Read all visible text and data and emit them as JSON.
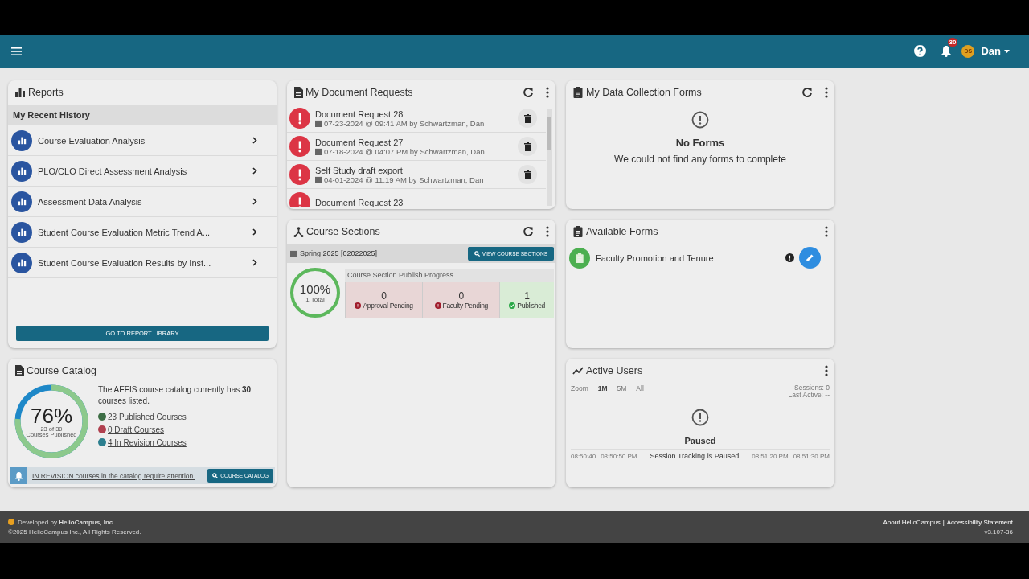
{
  "header": {
    "notification_count": "30",
    "avatar_initials": "DS",
    "user_name": "Dan"
  },
  "reports": {
    "title": "Reports",
    "section": "My Recent History",
    "items": [
      {
        "label": "Course Evaluation Analysis"
      },
      {
        "label": "PLO/CLO Direct Assessment Analysis"
      },
      {
        "label": "Assessment Data Analysis"
      },
      {
        "label": "Student Course Evaluation Metric Trend A..."
      },
      {
        "label": "Student Course Evaluation Results by Inst..."
      }
    ],
    "button": "GO TO REPORT LIBRARY"
  },
  "document_requests": {
    "title": "My Document Requests",
    "items": [
      {
        "title": "Document Request 28",
        "meta": "07-23-2024 @ 09:41 AM by Schwartzman, Dan"
      },
      {
        "title": "Document Request 27",
        "meta": "07-18-2024 @ 04:07 PM by Schwartzman, Dan"
      },
      {
        "title": "Self Study draft export",
        "meta": "04-01-2024 @ 11:19 AM by Schwartzman, Dan"
      },
      {
        "title": "Document Request 23"
      }
    ]
  },
  "data_collection_forms": {
    "title": "My Data Collection Forms",
    "empty_title": "No Forms",
    "empty_message": "We could not find any forms to complete"
  },
  "course_sections": {
    "title": "Course Sections",
    "term": "Spring 2025 [02022025]",
    "button": "VIEW COURSE SECTIONS",
    "percent": "100%",
    "total": "1 Total",
    "level": 1,
    "progress_title": "Course Section Publish Progress",
    "stages": [
      {
        "count": "0",
        "label": "Approval Pending",
        "kind": "pending"
      },
      {
        "count": "0",
        "label": "Faculty Pending",
        "kind": "pending"
      },
      {
        "count": "1",
        "label": "Published",
        "kind": "done"
      }
    ]
  },
  "available_forms": {
    "title": "Available Forms",
    "items": [
      {
        "name": "Faculty Promotion and Tenure"
      }
    ]
  },
  "course_catalog": {
    "title": "Course Catalog",
    "percent": "76%",
    "caption_1": "23 of 30",
    "caption_2": "Courses Published",
    "level": 0.76,
    "summary": "The AEFIS course catalog currently has **30** courses listed.",
    "statuses": [
      {
        "label": "23 Published Courses",
        "color": "#3d6e45"
      },
      {
        "label": "0 Draft Courses",
        "color": "#b0404f"
      },
      {
        "label": "4 In Revision Courses",
        "color": "#2c7f8f"
      }
    ],
    "alert": "IN REVISION courses in the catalog require attention.",
    "button": "COURSE CATALOG"
  },
  "active_users": {
    "title": "Active Users",
    "zoom_label": "Zoom",
    "ranges": [
      {
        "label": "1M",
        "selected": true
      },
      {
        "label": "5M",
        "selected": false
      },
      {
        "label": "All",
        "selected": false
      }
    ],
    "sessions": "Sessions: 0",
    "last_active": "Last Active: --",
    "axis_left": [
      "08:50:40",
      "08:50:50 PM"
    ],
    "axis_right": [
      "08:51:20 PM",
      "08:51:30 PM"
    ],
    "status_title": "Paused",
    "status_message": "Session Tracking is Paused"
  },
  "footer": {
    "developed_by": "Developed by **HelioCampus, Inc.**",
    "copyright": "©2025 HelioCampus Inc., All Rights Reserved.",
    "links": [
      "About HelioCampus",
      "Accessibility Statement"
    ],
    "separator": "|",
    "version": "v3.107-36"
  }
}
